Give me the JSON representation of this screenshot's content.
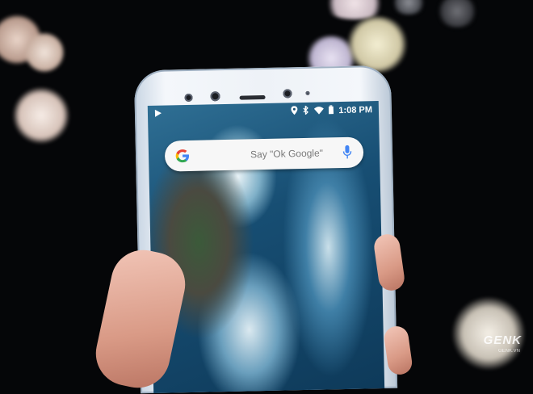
{
  "statusbar": {
    "time": "1:08 PM",
    "icons": [
      "play-store-icon",
      "location-icon",
      "bluetooth-icon",
      "wifi-icon",
      "battery-icon"
    ]
  },
  "search": {
    "placeholder": "Say \"Ok Google\"",
    "logo_letter": "G",
    "icons": [
      "google-logo-icon",
      "microphone-icon"
    ]
  },
  "watermark": {
    "brand": "GENK",
    "domain": "GENK.VN"
  },
  "colors": {
    "background": "#050608",
    "phone_body": "#eef2f7",
    "search_bar": "#f7f7f7",
    "google_blue": "#4285f4",
    "google_red": "#ea4335",
    "google_yellow": "#fbbc05",
    "google_green": "#34a853"
  }
}
